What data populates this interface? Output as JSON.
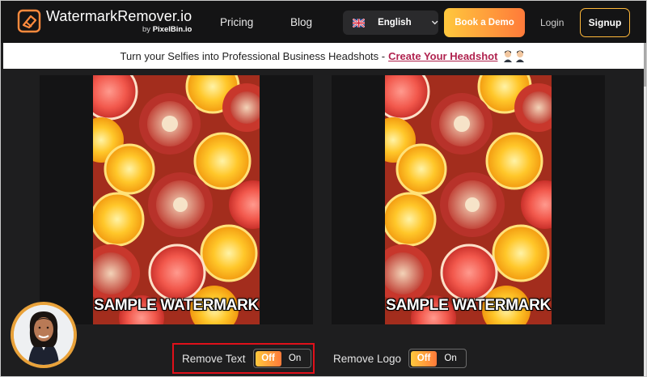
{
  "header": {
    "brand_name": "WatermarkRemover.io",
    "brand_by_prefix": "by ",
    "brand_by_name": "PixelBin.io",
    "nav": {
      "pricing": "Pricing",
      "blog": "Blog"
    },
    "language": {
      "selected": "English",
      "flag_icon": "uk-flag-icon"
    },
    "book_demo": "Book a Demo",
    "login": "Login",
    "signup": "Signup"
  },
  "promo": {
    "text": "Turn your Selfies into Professional Business Headshots -",
    "link": "Create Your Headshot"
  },
  "preview": {
    "left_watermark": "SAMPLE WATERMARK",
    "right_watermark": "SAMPLE WATERMARK"
  },
  "controls": {
    "remove_text": {
      "label": "Remove Text",
      "off": "Off",
      "on": "On",
      "active": "Off"
    },
    "remove_logo": {
      "label": "Remove Logo",
      "off": "Off",
      "on": "On",
      "active": "Off"
    }
  },
  "colors": {
    "accent_start": "#ffc83d",
    "accent_end": "#ff7a3a",
    "highlight_box": "#e0101a",
    "promo_link": "#b0234f"
  }
}
